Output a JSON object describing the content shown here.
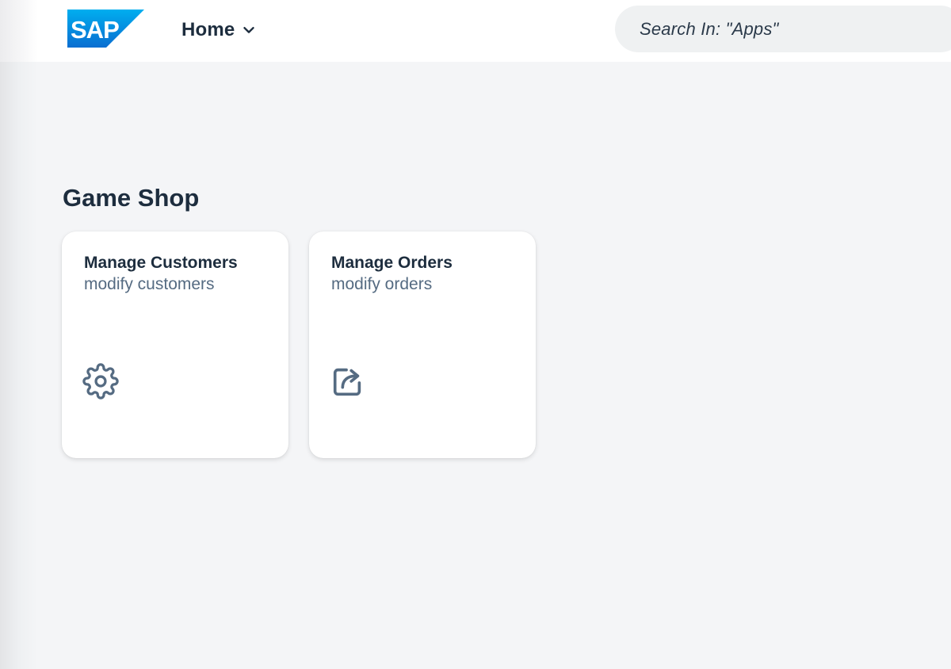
{
  "header": {
    "logo_text": "SAP",
    "home_label": "Home",
    "search_placeholder": "Search In: \"Apps\""
  },
  "group": {
    "title": "Game Shop",
    "tiles": [
      {
        "title": "Manage Customers",
        "subtitle": "modify customers",
        "icon": "gear-icon"
      },
      {
        "title": "Manage Orders",
        "subtitle": "modify orders",
        "icon": "share-icon"
      }
    ]
  },
  "colors": {
    "brand": "#0a6ed1",
    "text_primary": "#1d2d3e",
    "text_secondary": "#556b82",
    "icon": "#556b82",
    "background": "#f4f5f7"
  }
}
